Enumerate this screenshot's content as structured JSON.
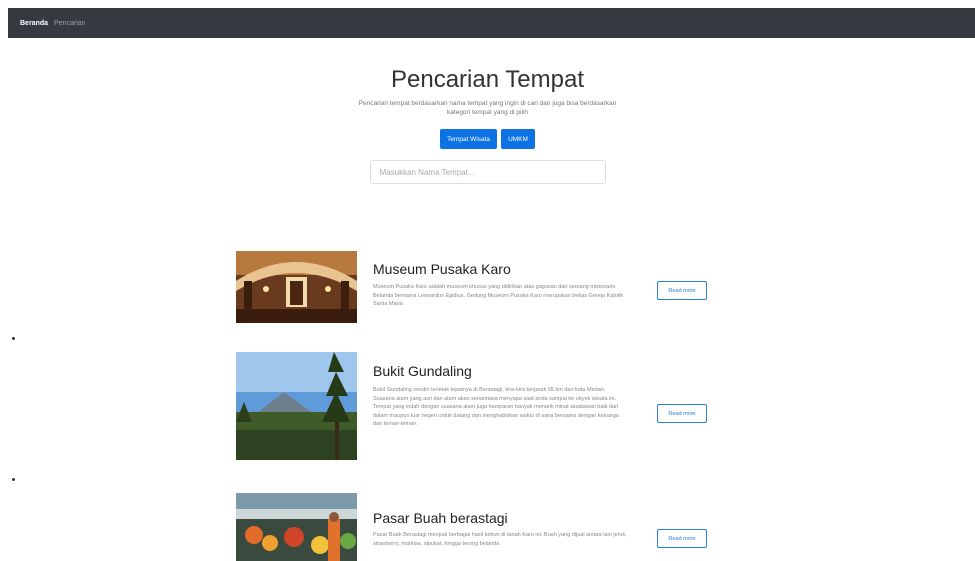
{
  "navbar": {
    "items": [
      "Beranda",
      "Pencarian"
    ]
  },
  "header": {
    "title": "Pencarian Tempat",
    "description": "Pencarian tempat berdasarkan nama tempat yang ingin di cari dan juga bisa berdasarkan kategori tempat yang di pilih",
    "buttons": [
      "Tempat Wisata",
      "UMKM"
    ],
    "search_placeholder": "Masukkan Nama Tempat..."
  },
  "places": [
    {
      "title": "Museum Pusaka Karo",
      "description": "Museum Pusaka Karo adalah museum khusus yang didirikan atas gagasan dari seorang misionaris Belanda bernama Leonardus Egidius. Gedung Museum Pusaka Karo merupakan bekas Gereja Katolik Santa Maria",
      "button": "Read more"
    },
    {
      "title": "Bukit Gundaling",
      "description": "Bukit Gundaling sendiri terletak tepatnya di Berastagi, kira-kira berjarak 65 km dari kota Medan. Suasana alam yang asri dan alam akan senantiasa menyapa saat anda sampai ke obyek wisata ini. Tempat yang indah dengan suasana alam juga hamparan banyak menarik minat wisatawan baik dari dalam maupun luar negeri untuk datang dan menghabiskan waktu di sana bersama dengan keluarga dan teman-teman.",
      "button": "Read more"
    },
    {
      "title": "Pasar Buah berastagi",
      "description": "Pasar Buah Berastagi menjual berbagai hasil kebun di tanah Karo ini. Buah yang dijual antara lain jeruk, strawberry, markisa, alpukat, hingga terong belanda",
      "button": "Read more"
    }
  ],
  "colors": {
    "navbar": "#343a40",
    "primary": "#0d72e4"
  },
  "icons": [
    "museum-photo",
    "mountain-photo",
    "market-photo"
  ]
}
